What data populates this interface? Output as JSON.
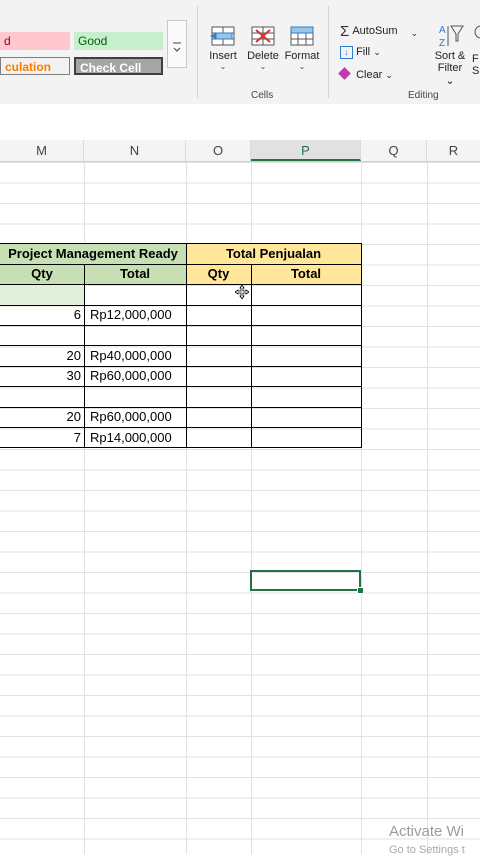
{
  "ribbon": {
    "styles": {
      "bad_partial": "d",
      "good": "Good",
      "calculation_partial": "culation",
      "check_cell": "Check Cell"
    },
    "cells": {
      "insert": "Insert",
      "delete": "Delete",
      "format": "Format",
      "group_label": "Cells"
    },
    "editing": {
      "autosum": "AutoSum",
      "fill": "Fill",
      "clear": "Clear",
      "sort_filter_line1": "Sort &",
      "sort_filter_line2": "Filter",
      "find_partial_line1": "F",
      "find_partial_line2": "S",
      "group_label": "Editing"
    },
    "colors": {
      "bad_bg": "#ffc7ce",
      "bad_text": "#9c0006",
      "good_bg": "#c6efce",
      "good_text": "#006100",
      "calc_bg": "#f2f2f2",
      "calc_text": "#fa7d00",
      "check_bg": "#a5a5a5",
      "check_text": "#ffffff"
    }
  },
  "columns": [
    "M",
    "N",
    "O",
    "P",
    "Q",
    "R"
  ],
  "selected_column": "P",
  "table": {
    "header_left": "Project Management Ready",
    "header_right": "Total Penjualan",
    "sub_qty_left": "Qty",
    "sub_total_left": "Total",
    "sub_qty_right": "Qty",
    "sub_total_right": "Total",
    "rows": [
      {
        "qty": "",
        "total": ""
      },
      {
        "qty": "6",
        "total": "Rp12,000,000"
      },
      {
        "qty": "",
        "total": ""
      },
      {
        "qty": "20",
        "total": "Rp40,000,000"
      },
      {
        "qty": "30",
        "total": "Rp60,000,000"
      },
      {
        "qty": "",
        "total": ""
      },
      {
        "qty": "20",
        "total": "Rp60,000,000"
      },
      {
        "qty": "7",
        "total": "Rp14,000,000"
      }
    ],
    "colors": {
      "green_header": "#c6e0b4",
      "yellow_header": "#ffe699"
    }
  },
  "watermark": {
    "line1": "Activate Wi",
    "line2": "Go to Settings t"
  }
}
